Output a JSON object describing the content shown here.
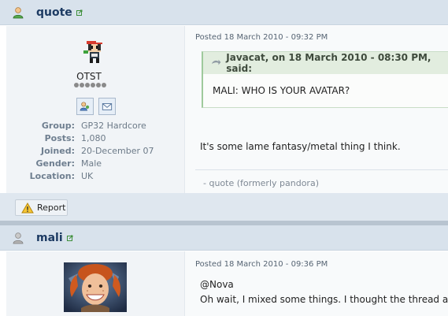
{
  "posts": [
    {
      "username": "quote",
      "author_name": "OTST",
      "posted": "Posted 18 March 2010 - 09:32 PM",
      "info": [
        {
          "label": "Group:",
          "value": "GP32 Hardcore"
        },
        {
          "label": "Posts:",
          "value": "1,080"
        },
        {
          "label": "Joined:",
          "value": "20-December 07"
        },
        {
          "label": "Gender:",
          "value": "Male"
        },
        {
          "label": "Location:",
          "value": "UK"
        }
      ],
      "quote_header": "Javacat, on 18 March 2010 - 08:30 PM, said:",
      "quote_body": "MALI: WHO IS YOUR AVATAR?",
      "message": "It's some lame fantasy/metal thing I think.",
      "signature": "- quote (formerly pandora)",
      "report_label": "Report"
    },
    {
      "username": "mali",
      "posted": "Posted 18 March 2010 - 09:36 PM",
      "message_line1": "@Nova",
      "message_line2": "Oh wait, I mixed some things. I thought the thread abo"
    }
  ]
}
